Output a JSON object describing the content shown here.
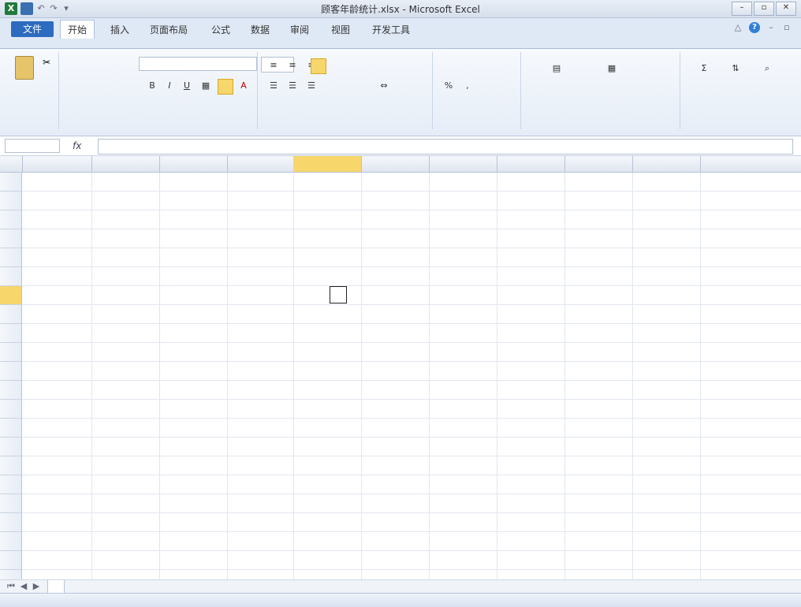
{
  "window": {
    "title": "顾客年龄统计.xlsx - Microsoft Excel"
  },
  "qat": {
    "app_icon": "excel-icon",
    "save": "save-icon",
    "undo": "undo-icon",
    "redo": "redo-icon",
    "dropdown": "dropdown-icon"
  },
  "ribbon": {
    "file_tab": "文件",
    "tabs": [
      {
        "label": "开始"
      },
      {
        "label": "插入"
      },
      {
        "label": "页面布局"
      },
      {
        "label": "公式"
      },
      {
        "label": "数据"
      },
      {
        "label": "审阅"
      },
      {
        "label": "视图"
      },
      {
        "label": "开发工具"
      }
    ],
    "active_tab": "开始"
  },
  "colors": {
    "ribbon_blue": "#2c6bbf",
    "selection_yellow": "#f7d66b"
  }
}
